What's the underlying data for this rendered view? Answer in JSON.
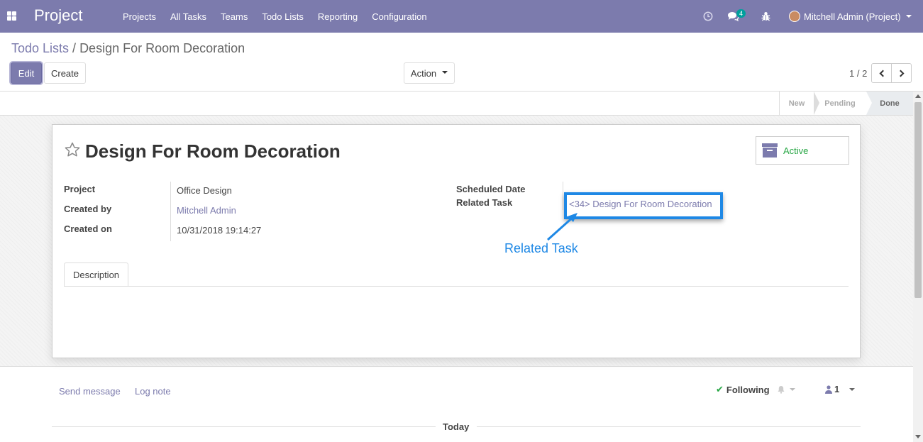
{
  "navbar": {
    "app_title": "Project",
    "menu": [
      "Projects",
      "All Tasks",
      "Teams",
      "Todo Lists",
      "Reporting",
      "Configuration"
    ],
    "messages_count": "4",
    "user_name": "Mitchell Admin (Project)"
  },
  "breadcrumb": {
    "parent": "Todo Lists",
    "separator": "/",
    "current": "Design For Room Decoration"
  },
  "buttons": {
    "edit": "Edit",
    "create": "Create",
    "action": "Action"
  },
  "pager": {
    "value": "1 / 2"
  },
  "stages": {
    "new": "New",
    "pending": "Pending",
    "done": "Done",
    "current": "Done"
  },
  "record": {
    "title": "Design For Room Decoration",
    "active_button": "Active",
    "fields": {
      "project_label": "Project",
      "project_value": "Office Design",
      "created_by_label": "Created by",
      "created_by_value": "Mitchell Admin",
      "created_on_label": "Created on",
      "created_on_value": "10/31/2018 19:14:27",
      "scheduled_date_label": "Scheduled Date",
      "scheduled_date_value": "",
      "related_task_label": "Related Task",
      "related_task_value": "<34> Design For Room Decoration"
    },
    "annotation": "Related Task",
    "tabs": [
      "Description"
    ]
  },
  "chatter": {
    "send_message": "Send message",
    "log_note": "Log note",
    "following": "Following",
    "followers_count": "1",
    "today": "Today"
  },
  "colors": {
    "brand": "#7c7bad",
    "active_green": "#28a745",
    "annotation_blue": "#1e88e5"
  }
}
